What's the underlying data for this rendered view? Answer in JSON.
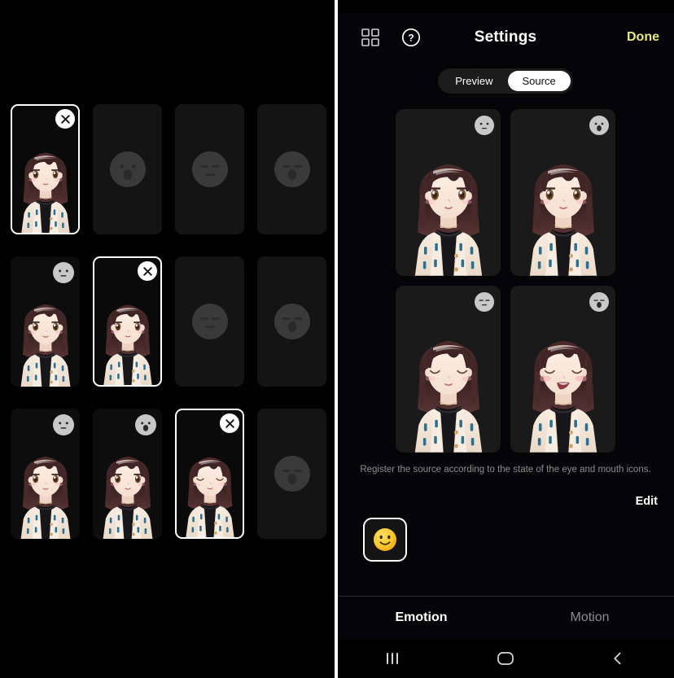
{
  "left_panel": {
    "name": "emotion-source-grid",
    "cells": [
      {
        "state": "filled-selected",
        "badge": null,
        "close": true,
        "avatar": "eyes-open-mouth-closed"
      },
      {
        "state": "empty",
        "badge": "eyes-open-mouth-open",
        "close": false,
        "avatar": null
      },
      {
        "state": "empty",
        "badge": "eyes-closed-mouth-line",
        "close": false,
        "avatar": null
      },
      {
        "state": "empty",
        "badge": "eyes-closed-mouth-open",
        "close": false,
        "avatar": null
      },
      {
        "state": "filled",
        "badge": "eyes-open-mouth-line",
        "close": false,
        "avatar": "eyes-open-mouth-closed"
      },
      {
        "state": "filled-selected",
        "badge": null,
        "close": true,
        "avatar": "eyes-open-mouth-closed"
      },
      {
        "state": "empty",
        "badge": "eyes-closed-mouth-line",
        "close": false,
        "avatar": null
      },
      {
        "state": "empty",
        "badge": "eyes-closed-mouth-open",
        "close": false,
        "avatar": null
      },
      {
        "state": "filled",
        "badge": "eyes-open-mouth-line",
        "close": false,
        "avatar": "eyes-open-mouth-closed"
      },
      {
        "state": "filled",
        "badge": "eyes-open-mouth-open",
        "close": false,
        "avatar": "eyes-open-mouth-closed"
      },
      {
        "state": "filled-selected",
        "badge": null,
        "close": true,
        "avatar": "eyes-closed-mouth-closed"
      },
      {
        "state": "empty",
        "badge": "eyes-closed-mouth-open",
        "close": false,
        "avatar": null
      }
    ]
  },
  "right_panel": {
    "header": {
      "grid_icon": "grid-icon",
      "help_icon": "help-icon",
      "title": "Settings",
      "done_label": "Done",
      "done_color": "#e6e884"
    },
    "segmented": {
      "options": [
        "Preview",
        "Source"
      ],
      "selected": "Source"
    },
    "source_cells": [
      {
        "badge": "eyes-open-mouth-line",
        "avatar": "eyes-open-mouth-closed"
      },
      {
        "badge": "eyes-open-mouth-open",
        "avatar": "eyes-open-mouth-closed"
      },
      {
        "badge": "eyes-closed-mouth-line",
        "avatar": "eyes-closed-mouth-closed"
      },
      {
        "badge": "eyes-closed-mouth-open",
        "avatar": "eyes-closed-mouth-open"
      }
    ],
    "caption": "Register the source according to the state of the eye and mouth icons.",
    "edit_label": "Edit",
    "emoji_tiles": [
      {
        "glyph": "smiley-face-icon",
        "selected": true
      }
    ],
    "tabs": [
      {
        "label": "Emotion",
        "active": true
      },
      {
        "label": "Motion",
        "active": false
      }
    ],
    "navbar": {
      "recents": "recents-icon",
      "home": "home-icon",
      "back": "back-icon"
    }
  },
  "colors": {
    "accent_done": "#e6e884",
    "panel_bg": "#050508",
    "cell_bg": "#141414",
    "source_cell_bg": "#1a1a1a",
    "caption_text": "#8d8d8d",
    "inactive_tab": "#8b8d93"
  }
}
